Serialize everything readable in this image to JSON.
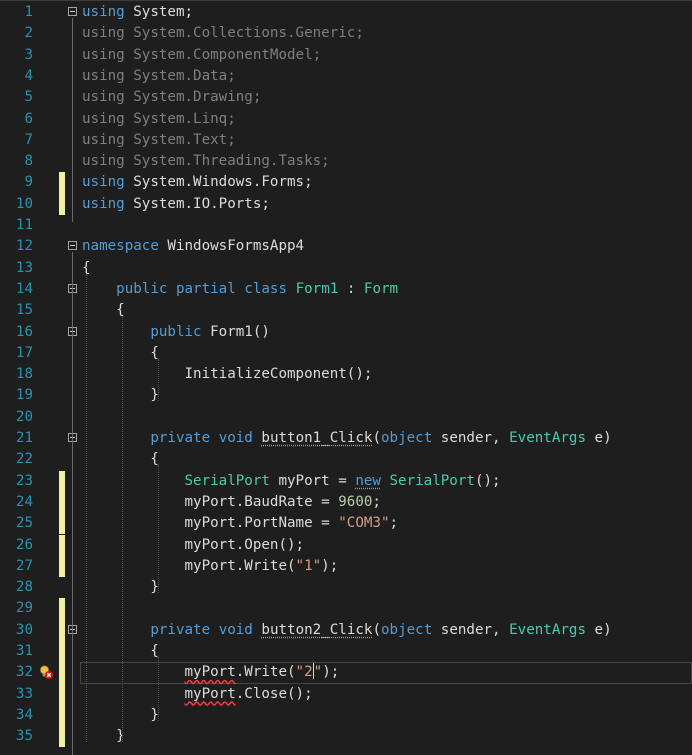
{
  "editor": {
    "lines": [
      {
        "n": "1",
        "tokens": [
          [
            "k",
            "using"
          ],
          [
            "p",
            " System;"
          ]
        ],
        "fold": true
      },
      {
        "n": "2",
        "dim": true,
        "tokens": [
          [
            "dk",
            "using"
          ],
          [
            "d",
            " System.Collections.Generic;"
          ]
        ]
      },
      {
        "n": "3",
        "dim": true,
        "tokens": [
          [
            "dk",
            "using"
          ],
          [
            "d",
            " System.ComponentModel;"
          ]
        ]
      },
      {
        "n": "4",
        "dim": true,
        "tokens": [
          [
            "dk",
            "using"
          ],
          [
            "d",
            " System.Data;"
          ]
        ]
      },
      {
        "n": "5",
        "dim": true,
        "tokens": [
          [
            "dk",
            "using"
          ],
          [
            "d",
            " System.Drawing;"
          ]
        ]
      },
      {
        "n": "6",
        "dim": true,
        "tokens": [
          [
            "dk",
            "using"
          ],
          [
            "d",
            " System.Linq;"
          ]
        ]
      },
      {
        "n": "7",
        "dim": true,
        "tokens": [
          [
            "dk",
            "using"
          ],
          [
            "d",
            " System.Text;"
          ]
        ]
      },
      {
        "n": "8",
        "dim": true,
        "tokens": [
          [
            "dk",
            "using"
          ],
          [
            "d",
            " System.Threading.Tasks;"
          ]
        ]
      },
      {
        "n": "9",
        "changed": true,
        "tokens": [
          [
            "k",
            "using"
          ],
          [
            "p",
            " System.Windows.Forms;"
          ]
        ]
      },
      {
        "n": "10",
        "changed": true,
        "tokens": [
          [
            "k",
            "using"
          ],
          [
            "p",
            " System.IO.Ports;"
          ]
        ]
      },
      {
        "n": "11",
        "tokens": []
      },
      {
        "n": "12",
        "fold": true,
        "tokens": [
          [
            "k",
            "namespace"
          ],
          [
            "p",
            " WindowsFormsApp4"
          ]
        ]
      },
      {
        "n": "13",
        "tokens": [
          [
            "p",
            "{"
          ]
        ]
      },
      {
        "n": "14",
        "fold": true,
        "tokens": [
          [
            "p",
            "    "
          ],
          [
            "k",
            "public"
          ],
          [
            "p",
            " "
          ],
          [
            "k",
            "partial"
          ],
          [
            "p",
            " "
          ],
          [
            "k",
            "class"
          ],
          [
            "p",
            " "
          ],
          [
            "t",
            "Form1"
          ],
          [
            "p",
            " : "
          ],
          [
            "t",
            "Form"
          ]
        ]
      },
      {
        "n": "15",
        "tokens": [
          [
            "p",
            "    {"
          ]
        ]
      },
      {
        "n": "16",
        "fold": true,
        "tokens": [
          [
            "p",
            "        "
          ],
          [
            "k",
            "public"
          ],
          [
            "p",
            " Form1()"
          ]
        ]
      },
      {
        "n": "17",
        "tokens": [
          [
            "p",
            "        {"
          ]
        ]
      },
      {
        "n": "18",
        "tokens": [
          [
            "p",
            "            InitializeComponent();"
          ]
        ]
      },
      {
        "n": "19",
        "tokens": [
          [
            "p",
            "        }"
          ]
        ]
      },
      {
        "n": "20",
        "tokens": []
      },
      {
        "n": "21",
        "fold": true,
        "tokens": [
          [
            "p",
            "        "
          ],
          [
            "k",
            "private"
          ],
          [
            "p",
            " "
          ],
          [
            "k",
            "void"
          ],
          [
            "p",
            " "
          ],
          [
            "r",
            "button1_Click"
          ],
          [
            "p",
            "("
          ],
          [
            "k",
            "object"
          ],
          [
            "p",
            " sender, "
          ],
          [
            "t",
            "EventArgs"
          ],
          [
            "p",
            " e)"
          ]
        ]
      },
      {
        "n": "22",
        "tokens": [
          [
            "p",
            "        {"
          ]
        ]
      },
      {
        "n": "23",
        "changed": true,
        "tokens": [
          [
            "p",
            "            "
          ],
          [
            "t",
            "SerialPort"
          ],
          [
            "p",
            " myPort = "
          ],
          [
            "kr",
            "new"
          ],
          [
            "p",
            " "
          ],
          [
            "t",
            "SerialPort"
          ],
          [
            "p",
            "();"
          ]
        ]
      },
      {
        "n": "24",
        "changed": true,
        "tokens": [
          [
            "p",
            "            myPort.BaudRate = "
          ],
          [
            "n",
            "9600"
          ],
          [
            "p",
            ";"
          ]
        ]
      },
      {
        "n": "25",
        "changed": true,
        "tokens": [
          [
            "p",
            "            myPort.PortName = "
          ],
          [
            "s",
            "\"COM3\""
          ],
          [
            "p",
            ";"
          ]
        ]
      },
      {
        "n": "26",
        "changed": true,
        "tokens": [
          [
            "p",
            "            myPort.Open();"
          ]
        ]
      },
      {
        "n": "27",
        "changed": true,
        "tokens": [
          [
            "p",
            "            myPort.Write("
          ],
          [
            "s",
            "\"1\""
          ],
          [
            "p",
            ");"
          ]
        ]
      },
      {
        "n": "28",
        "tokens": [
          [
            "p",
            "        }"
          ]
        ]
      },
      {
        "n": "29",
        "changed": true,
        "tokens": []
      },
      {
        "n": "30",
        "changed": true,
        "fold": true,
        "tokens": [
          [
            "p",
            "        "
          ],
          [
            "k",
            "private"
          ],
          [
            "p",
            " "
          ],
          [
            "k",
            "void"
          ],
          [
            "p",
            " "
          ],
          [
            "r",
            "button2_Click"
          ],
          [
            "p",
            "("
          ],
          [
            "k",
            "object"
          ],
          [
            "p",
            " sender, "
          ],
          [
            "t",
            "EventArgs"
          ],
          [
            "p",
            " e)"
          ]
        ]
      },
      {
        "n": "31",
        "changed": true,
        "tokens": [
          [
            "p",
            "        {"
          ]
        ]
      },
      {
        "n": "32",
        "changed": true,
        "current": true,
        "glyph": "error-lightbulb",
        "tokens": [
          [
            "p",
            "            "
          ],
          [
            "e",
            "myPort"
          ],
          [
            "p",
            ".Write("
          ],
          [
            "s",
            "\"2"
          ],
          [
            "c",
            ""
          ],
          [
            "s",
            "\""
          ],
          [
            "p",
            ");"
          ]
        ]
      },
      {
        "n": "33",
        "changed": true,
        "tokens": [
          [
            "p",
            "            "
          ],
          [
            "e",
            "myPort"
          ],
          [
            "p",
            ".Close();"
          ]
        ]
      },
      {
        "n": "34",
        "changed": true,
        "tokens": [
          [
            "p",
            "        }"
          ]
        ]
      },
      {
        "n": "35",
        "changed": true,
        "tokens": [
          [
            "p",
            "    }"
          ]
        ]
      }
    ]
  }
}
